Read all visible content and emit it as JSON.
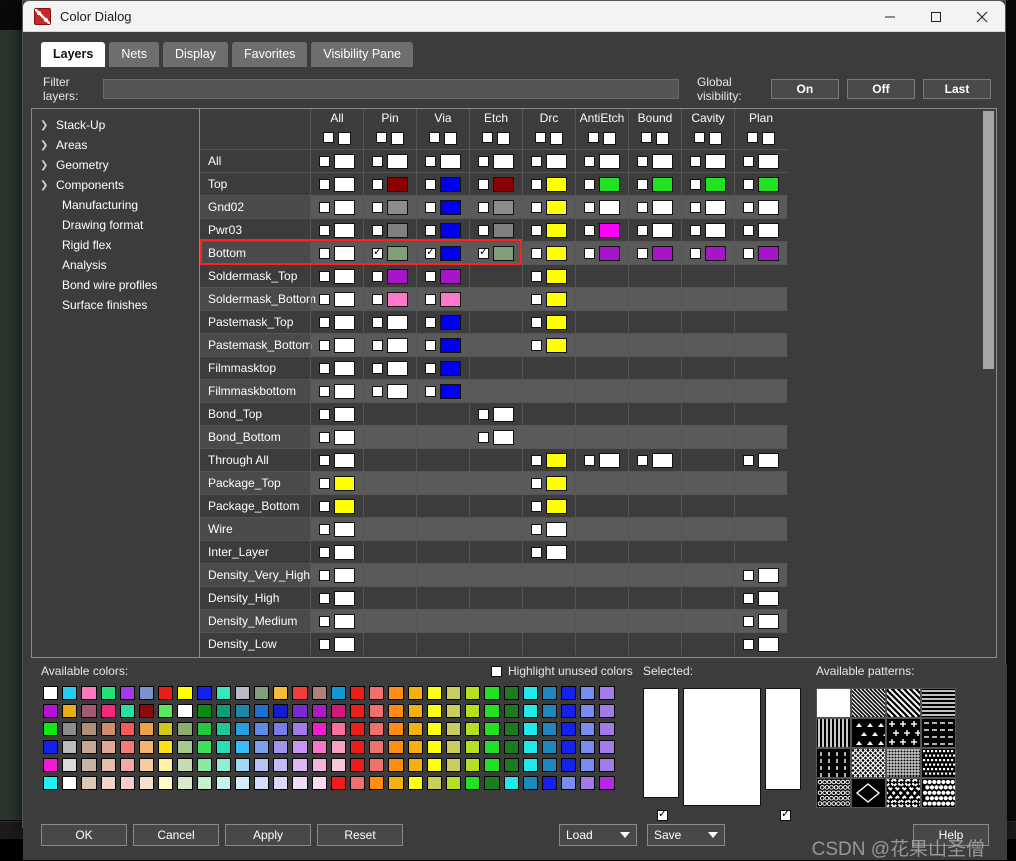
{
  "window": {
    "title": "Color Dialog",
    "icon": "color-dialog-icon",
    "controls": {
      "minimize": "minimize-icon",
      "maximize": "maximize-icon",
      "close": "close-icon"
    }
  },
  "tabs": [
    {
      "label": "Layers",
      "active": true
    },
    {
      "label": "Nets",
      "active": false
    },
    {
      "label": "Display",
      "active": false
    },
    {
      "label": "Favorites",
      "active": false
    },
    {
      "label": "Visibility Pane",
      "active": false
    }
  ],
  "filter": {
    "label": "Filter layers:",
    "value": "",
    "placeholder": ""
  },
  "global_visibility": {
    "label": "Global visibility:",
    "buttons": [
      "On",
      "Off",
      "Last"
    ]
  },
  "tree": [
    {
      "label": "Stack-Up",
      "expandable": true
    },
    {
      "label": "Areas",
      "expandable": true
    },
    {
      "label": "Geometry",
      "expandable": true
    },
    {
      "label": "Components",
      "expandable": true
    },
    {
      "label": "Manufacturing",
      "expandable": false
    },
    {
      "label": "Drawing format",
      "expandable": false
    },
    {
      "label": "Rigid flex",
      "expandable": false
    },
    {
      "label": "Analysis",
      "expandable": false
    },
    {
      "label": "Bond wire profiles",
      "expandable": false
    },
    {
      "label": "Surface finishes",
      "expandable": false
    }
  ],
  "table": {
    "columns": [
      "All",
      "Pin",
      "Via",
      "Etch",
      "Drc",
      "AntiEtch",
      "Bound",
      "Cavity",
      "Plan"
    ],
    "highlighted_row": "Bottom",
    "rows": [
      {
        "name": "All",
        "band": "a",
        "cells": [
          {
            "cb": false,
            "sw": null
          },
          {
            "cb": false,
            "sw": null
          },
          {
            "cb": false,
            "sw": null
          },
          {
            "cb": false,
            "sw": null
          },
          {
            "cb": false,
            "sw": null
          },
          {
            "cb": false,
            "sw": null
          },
          {
            "cb": false,
            "sw": null
          },
          {
            "cb": false,
            "sw": null
          },
          {
            "cb": false,
            "sw": null
          }
        ]
      },
      {
        "name": "Top",
        "band": "a",
        "cells": [
          {
            "cb": false,
            "sw": "#ffffff"
          },
          {
            "cb": false,
            "sw": "#8b0000"
          },
          {
            "cb": false,
            "sw": "#0000ee"
          },
          {
            "cb": false,
            "sw": "#8b0000"
          },
          {
            "cb": false,
            "sw": "#ffff00"
          },
          {
            "cb": false,
            "sw": "#22e022"
          },
          {
            "cb": false,
            "sw": "#22e022"
          },
          {
            "cb": false,
            "sw": "#22e022"
          },
          {
            "cb": false,
            "sw": "#22e022"
          }
        ]
      },
      {
        "name": "Gnd02",
        "band": "b",
        "cells": [
          {
            "cb": false,
            "sw": "#ffffff"
          },
          {
            "cb": false,
            "sw": "#8c8c8c"
          },
          {
            "cb": false,
            "sw": "#0000ee"
          },
          {
            "cb": false,
            "sw": "#8c8c8c"
          },
          {
            "cb": false,
            "sw": "#ffff00"
          },
          {
            "cb": false,
            "sw": "#ffffff"
          },
          {
            "cb": false,
            "sw": "#ffffff"
          },
          {
            "cb": false,
            "sw": "#ffffff"
          },
          {
            "cb": false,
            "sw": "#ffffff"
          }
        ]
      },
      {
        "name": "Pwr03",
        "band": "a",
        "cells": [
          {
            "cb": false,
            "sw": "#ffffff"
          },
          {
            "cb": false,
            "sw": "#808080"
          },
          {
            "cb": false,
            "sw": "#0000ee"
          },
          {
            "cb": false,
            "sw": "#808080"
          },
          {
            "cb": false,
            "sw": "#ffff00"
          },
          {
            "cb": false,
            "sw": "#ff00ff"
          },
          {
            "cb": false,
            "sw": "#ffffff"
          },
          {
            "cb": false,
            "sw": "#ffffff"
          },
          {
            "cb": false,
            "sw": "#ffffff"
          }
        ]
      },
      {
        "name": "Bottom",
        "band": "b",
        "cells": [
          {
            "cb": false,
            "sw": "#ffffff"
          },
          {
            "cb": true,
            "sw": "#7f9e79"
          },
          {
            "cb": true,
            "sw": "#0000ee"
          },
          {
            "cb": true,
            "sw": "#7f9e79"
          },
          {
            "cb": false,
            "sw": "#ffff00"
          },
          {
            "cb": false,
            "sw": "#a814c8"
          },
          {
            "cb": false,
            "sw": "#a814c8"
          },
          {
            "cb": false,
            "sw": "#a814c8"
          },
          {
            "cb": false,
            "sw": "#a814c8"
          }
        ]
      },
      {
        "name": "Soldermask_Top",
        "band": "a",
        "cells": [
          {
            "cb": false,
            "sw": "#ffffff"
          },
          {
            "cb": false,
            "sw": "#a814c8"
          },
          {
            "cb": false,
            "sw": "#a814c8"
          },
          null,
          {
            "cb": false,
            "sw": "#ffff00"
          },
          null,
          null,
          null,
          null
        ]
      },
      {
        "name": "Soldermask_Bottom",
        "band": "b",
        "cells": [
          {
            "cb": false,
            "sw": "#ffffff"
          },
          {
            "cb": false,
            "sw": "#ff77c8"
          },
          {
            "cb": false,
            "sw": "#ff77c8"
          },
          null,
          {
            "cb": false,
            "sw": "#ffff00"
          },
          null,
          null,
          null,
          null
        ]
      },
      {
        "name": "Pastemask_Top",
        "band": "a",
        "cells": [
          {
            "cb": false,
            "sw": "#ffffff"
          },
          {
            "cb": false,
            "sw": "#ffffff"
          },
          {
            "cb": false,
            "sw": "#0000ee"
          },
          null,
          {
            "cb": false,
            "sw": "#ffff00"
          },
          null,
          null,
          null,
          null
        ]
      },
      {
        "name": "Pastemask_Bottom",
        "band": "b",
        "cells": [
          {
            "cb": false,
            "sw": "#ffffff"
          },
          {
            "cb": false,
            "sw": "#ffffff"
          },
          {
            "cb": false,
            "sw": "#0000ee"
          },
          null,
          {
            "cb": false,
            "sw": "#ffff00"
          },
          null,
          null,
          null,
          null
        ]
      },
      {
        "name": "Filmmasktop",
        "band": "a",
        "cells": [
          {
            "cb": false,
            "sw": "#ffffff"
          },
          {
            "cb": false,
            "sw": "#ffffff"
          },
          {
            "cb": false,
            "sw": "#0000ee"
          },
          null,
          null,
          null,
          null,
          null,
          null
        ]
      },
      {
        "name": "Filmmaskbottom",
        "band": "b",
        "cells": [
          {
            "cb": false,
            "sw": "#ffffff"
          },
          {
            "cb": false,
            "sw": "#ffffff"
          },
          {
            "cb": false,
            "sw": "#0000ee"
          },
          null,
          null,
          null,
          null,
          null,
          null
        ]
      },
      {
        "name": "Bond_Top",
        "band": "a",
        "cells": [
          {
            "cb": false,
            "sw": "#ffffff"
          },
          null,
          null,
          {
            "cb": false,
            "sw": "#ffffff"
          },
          null,
          null,
          null,
          null,
          null
        ]
      },
      {
        "name": "Bond_Bottom",
        "band": "b",
        "cells": [
          {
            "cb": false,
            "sw": "#ffffff"
          },
          null,
          null,
          {
            "cb": false,
            "sw": "#ffffff"
          },
          null,
          null,
          null,
          null,
          null
        ]
      },
      {
        "name": "Through All",
        "band": "a",
        "cells": [
          {
            "cb": false,
            "sw": "#ffffff"
          },
          null,
          null,
          null,
          {
            "cb": false,
            "sw": "#ffff00"
          },
          {
            "cb": false,
            "sw": "#ffffff"
          },
          {
            "cb": false,
            "sw": "#ffffff"
          },
          null,
          {
            "cb": false,
            "sw": "#ffffff"
          }
        ]
      },
      {
        "name": "Package_Top",
        "band": "b",
        "cells": [
          {
            "cb": false,
            "sw": "#ffff00"
          },
          null,
          null,
          null,
          {
            "cb": false,
            "sw": "#ffff00"
          },
          null,
          null,
          null,
          null
        ]
      },
      {
        "name": "Package_Bottom",
        "band": "a",
        "cells": [
          {
            "cb": false,
            "sw": "#ffff00"
          },
          null,
          null,
          null,
          {
            "cb": false,
            "sw": "#ffff00"
          },
          null,
          null,
          null,
          null
        ]
      },
      {
        "name": "Wire",
        "band": "b",
        "cells": [
          {
            "cb": false,
            "sw": "#ffffff"
          },
          null,
          null,
          null,
          {
            "cb": false,
            "sw": "#ffffff"
          },
          null,
          null,
          null,
          null
        ]
      },
      {
        "name": "Inter_Layer",
        "band": "a",
        "cells": [
          {
            "cb": false,
            "sw": "#ffffff"
          },
          null,
          null,
          null,
          {
            "cb": false,
            "sw": "#ffffff"
          },
          null,
          null,
          null,
          null
        ]
      },
      {
        "name": "Density_Very_High",
        "band": "b",
        "cells": [
          {
            "cb": false,
            "sw": "#ffffff"
          },
          null,
          null,
          null,
          null,
          null,
          null,
          null,
          {
            "cb": false,
            "sw": "#ffffff"
          }
        ]
      },
      {
        "name": "Density_High",
        "band": "a",
        "cells": [
          {
            "cb": false,
            "sw": "#ffffff"
          },
          null,
          null,
          null,
          null,
          null,
          null,
          null,
          {
            "cb": false,
            "sw": "#ffffff"
          }
        ]
      },
      {
        "name": "Density_Medium",
        "band": "b",
        "cells": [
          {
            "cb": false,
            "sw": "#ffffff"
          },
          null,
          null,
          null,
          null,
          null,
          null,
          null,
          {
            "cb": false,
            "sw": "#ffffff"
          }
        ]
      },
      {
        "name": "Density_Low",
        "band": "a",
        "cells": [
          {
            "cb": false,
            "sw": "#ffffff"
          },
          null,
          null,
          null,
          null,
          null,
          null,
          null,
          {
            "cb": false,
            "sw": "#ffffff"
          }
        ]
      }
    ]
  },
  "bottom": {
    "available_colors_label": "Available colors:",
    "highlight_unused_label": "Highlight unused colors",
    "highlight_unused_checked": false,
    "selected_label": "Selected:",
    "available_patterns_label": "Available patterns:",
    "selected_swatches": [
      "#ffffff",
      "#ffffff",
      "#ffffff"
    ],
    "selected_checks": [
      true,
      true
    ],
    "palette": [
      [
        "#ffffff",
        "#22cdf0",
        "#ff78be",
        "#22e07c",
        "#a33ce8",
        "#7b93c6",
        "#ef1b1b",
        "#ffff00",
        "#1421ee",
        "#35e8bc",
        "#b9bcc4",
        "#7f9e79",
        "#f5bb3c",
        "#f53c3c",
        "#ad8079",
        "#1497d1",
        "#f01b1b",
        "#f0706e",
        "#ff8c14",
        "#f5b014",
        "#ffff14",
        "#c8cd5e",
        "#b4e024",
        "#24e024",
        "#1e7a1e",
        "#24e8e8",
        "#1e87bc",
        "#1421ee",
        "#7b8cf0",
        "#a37be8",
        "#b428e8",
        "#f51bd1"
      ],
      [
        "#b414d1",
        "#e8ad14",
        "#a35a70",
        "#f5287c",
        "#28e0a3",
        "#8c0a0a",
        "#5ce85c",
        "#ffffff",
        "#0a8c14",
        "#0f9e78",
        "#1e87a8",
        "#1e70d1",
        "#141bd1",
        "#7b28d1",
        "#ad1bc8",
        "#d11b78",
        "#f01b1b",
        "#f0706e",
        "#ff8c14",
        "#f5b014",
        "#ffff14",
        "#c8cd5e",
        "#b4e024",
        "#24e024",
        "#1e7a1e",
        "#24e8e8",
        "#1e87bc",
        "#1421ee",
        "#7b8cf0",
        "#a37be8",
        "#b428e8",
        "#f51bd1"
      ],
      [
        "#14e814",
        "#8c8c8c",
        "#b08f78",
        "#cd8c6e",
        "#f55a5a",
        "#f0a04b",
        "#d1c814",
        "#8cad6e",
        "#24c83c",
        "#1ec894",
        "#28a0e0",
        "#5a8ce8",
        "#7b7be8",
        "#a37be8",
        "#f51bd1",
        "#f5709e",
        "#f01b1b",
        "#f0706e",
        "#ff8c14",
        "#f5b014",
        "#ffff14",
        "#c8cd5e",
        "#b4e024",
        "#24e024",
        "#1e7a1e",
        "#24e8e8",
        "#1e87bc",
        "#1421ee",
        "#7b8cf0",
        "#a37be8",
        "#b428e8",
        "#f51bd1"
      ],
      [
        "#1421ee",
        "#bcbcbc",
        "#c4a894",
        "#e0a894",
        "#f57b7b",
        "#f5b470",
        "#ffe014",
        "#a8c88c",
        "#3ce05a",
        "#28e0b4",
        "#3cbcf5",
        "#7ba0f0",
        "#a094f0",
        "#c894f5",
        "#f578c8",
        "#f5a0c4",
        "#f01b1b",
        "#f0706e",
        "#ff8c14",
        "#f5b014",
        "#ffff14",
        "#c8cd5e",
        "#b4e024",
        "#24e024",
        "#1e7a1e",
        "#24e8e8",
        "#1e87bc",
        "#1421ee",
        "#7b8cf0",
        "#a37be8",
        "#b428e8",
        "#f51bd1"
      ],
      [
        "#f51bd1",
        "#dcdcdc",
        "#c8b4a0",
        "#e8bcac",
        "#f5a8a8",
        "#f5cda0",
        "#fff5a0",
        "#c4dcb4",
        "#8ce8a0",
        "#8cf0d1",
        "#a0d8f5",
        "#b4c4f5",
        "#c4bcf5",
        "#ddb8f5",
        "#f5b4dc",
        "#f5c8dc",
        "#f01b1b",
        "#f0706e",
        "#ff8c14",
        "#f5b014",
        "#ffff14",
        "#c8cd5e",
        "#b4e024",
        "#24e024",
        "#1e7a1e",
        "#24e8e8",
        "#1e87bc",
        "#1421ee",
        "#7b8cf0",
        "#a37be8",
        "#b428e8",
        "#f51bd1"
      ],
      [
        "#24f0f0",
        "#ffffff",
        "#d8c8b4",
        "#f0d4c8",
        "#f5cdcd",
        "#f5e0cd",
        "#fffcc8",
        "#d8e8cd",
        "#c4f0cd",
        "#c4f5e8",
        "#d4ecfa",
        "#d4dcfa",
        "#dcd8fa",
        "#eedcfa",
        "#fadcee",
        "#f01b1b",
        "#f0706e",
        "#ff8c14",
        "#f5b014",
        "#ffff14",
        "#c8cd5e",
        "#b4e024",
        "#24e024",
        "#1e7a1e",
        "#24e8e8",
        "#1e87bc",
        "#1421ee",
        "#7b8cf0",
        "#a37be8",
        "#b428e8",
        "#f51bd1",
        "#f51bd1"
      ]
    ],
    "patterns": [
      "solid-white",
      "diagonal-hatch-left",
      "diagonal-stripes-right",
      "horizontal-lines",
      "vertical-lines",
      "triangles",
      "plus-signs",
      "dashed-lines",
      "dotted-vertical-dashes",
      "cross-hatch-diagonal",
      "fine-grid",
      "small-dots-diamond",
      "circles-mesh",
      "single-diamond",
      "diagonal-cross-dots",
      "checkered-dots"
    ]
  },
  "footer": {
    "buttons": [
      "OK",
      "Cancel",
      "Apply",
      "Reset"
    ],
    "load_label": "Load",
    "save_label": "Save",
    "help_label": "Help",
    "watermark": "CSDN @花果山圣僧"
  }
}
